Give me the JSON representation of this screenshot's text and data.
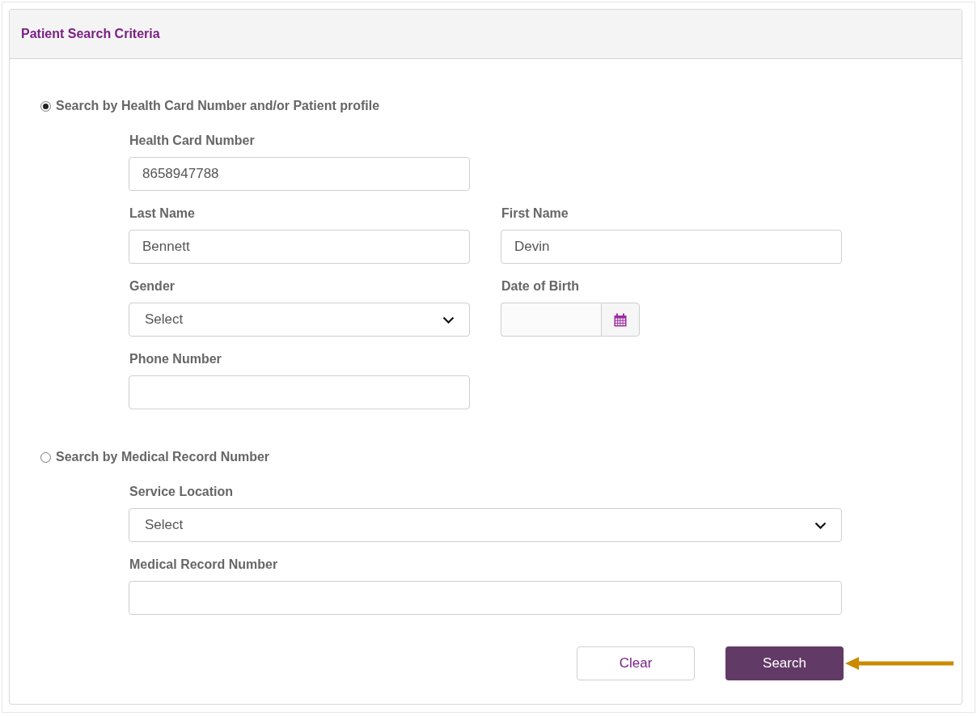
{
  "panel": {
    "title": "Patient Search Criteria"
  },
  "search_options": [
    {
      "label": "Search by Health Card Number and/or Patient profile",
      "selected": true,
      "rows": [
        [
          {
            "kind": "text",
            "label": "Health Card Number",
            "value": "8658947788"
          }
        ],
        [
          {
            "kind": "text",
            "label": "Last Name",
            "value": "Bennett"
          },
          {
            "kind": "text",
            "label": "First Name",
            "value": "Devin"
          }
        ],
        [
          {
            "kind": "select",
            "label": "Gender",
            "value": "Select"
          },
          {
            "kind": "date",
            "label": "Date of Birth"
          }
        ],
        [
          {
            "kind": "text",
            "label": "Phone Number"
          }
        ]
      ]
    },
    {
      "label": "Search by Medical Record Number",
      "selected": false,
      "rows": [
        [
          {
            "kind": "select",
            "label": "Service Location",
            "value": "Select"
          }
        ],
        [
          {
            "kind": "text",
            "label": "Medical Record Number"
          }
        ]
      ]
    }
  ],
  "buttons": [
    {
      "label": "Clear",
      "kind": "secondary"
    },
    {
      "label": "Search",
      "kind": "primary"
    }
  ]
}
